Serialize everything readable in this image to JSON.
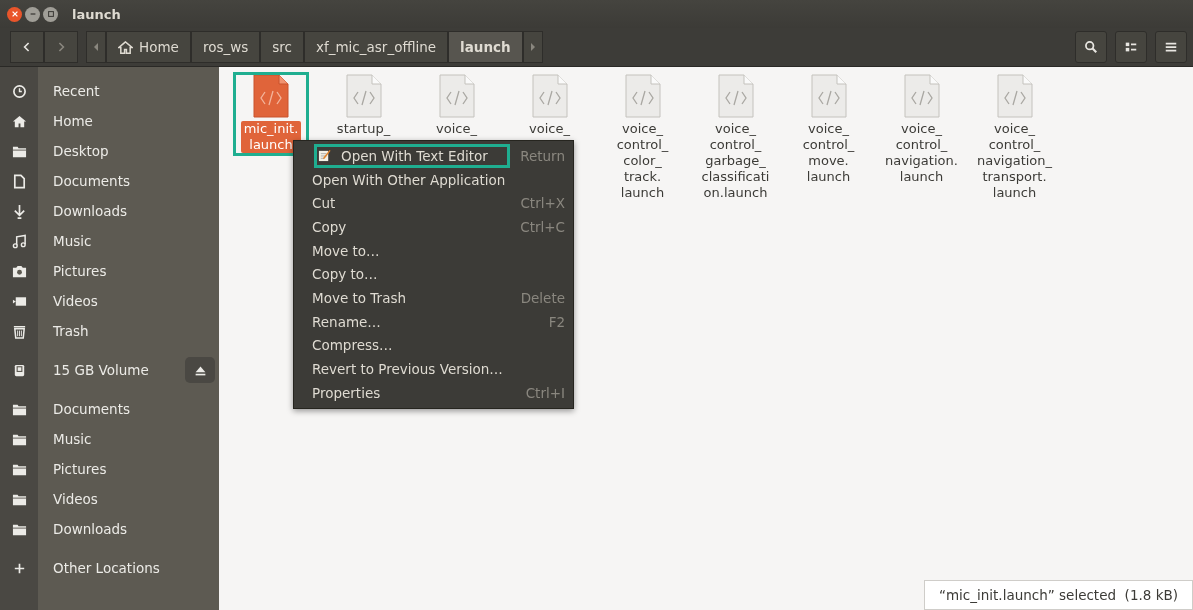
{
  "window": {
    "title": "launch"
  },
  "path_bar": [
    {
      "label": "Home",
      "selected": false
    },
    {
      "label": "ros_ws",
      "selected": false
    },
    {
      "label": "src",
      "selected": false
    },
    {
      "label": "xf_mic_asr_offline",
      "selected": false
    },
    {
      "label": "launch",
      "selected": true
    }
  ],
  "sidebar": {
    "items": [
      {
        "kind": "place",
        "label": "Recent"
      },
      {
        "kind": "place",
        "label": "Home"
      },
      {
        "kind": "place",
        "label": "Desktop"
      },
      {
        "kind": "place",
        "label": "Documents"
      },
      {
        "kind": "place",
        "label": "Downloads"
      },
      {
        "kind": "place",
        "label": "Music"
      },
      {
        "kind": "place",
        "label": "Pictures"
      },
      {
        "kind": "place",
        "label": "Videos"
      },
      {
        "kind": "place",
        "label": "Trash"
      },
      {
        "kind": "device",
        "label": "15 GB Volume"
      },
      {
        "kind": "bookmark",
        "label": "Documents"
      },
      {
        "kind": "bookmark",
        "label": "Music"
      },
      {
        "kind": "bookmark",
        "label": "Pictures"
      },
      {
        "kind": "bookmark",
        "label": "Videos"
      },
      {
        "kind": "bookmark",
        "label": "Downloads"
      },
      {
        "kind": "other",
        "label": "Other Locations"
      }
    ]
  },
  "files": [
    {
      "lines": [
        "mic_init.",
        "launch"
      ],
      "selected": true,
      "highlighted": true
    },
    {
      "lines": [
        "startup_"
      ],
      "selected": false,
      "highlighted": false
    },
    {
      "lines": [
        "voice_"
      ],
      "selected": false,
      "highlighted": false
    },
    {
      "lines": [
        "voice_"
      ],
      "selected": false,
      "highlighted": false
    },
    {
      "lines": [
        "voice_",
        "control_",
        "color_",
        "track.",
        "launch"
      ],
      "selected": false,
      "highlighted": false
    },
    {
      "lines": [
        "voice_",
        "control_",
        "garbage_",
        "classificati",
        "on.launch"
      ],
      "selected": false,
      "highlighted": false
    },
    {
      "lines": [
        "voice_",
        "control_",
        "move.",
        "launch"
      ],
      "selected": false,
      "highlighted": false
    },
    {
      "lines": [
        "voice_",
        "control_",
        "navigation.",
        "launch"
      ],
      "selected": false,
      "highlighted": false
    },
    {
      "lines": [
        "voice_",
        "control_",
        "navigation_",
        "transport.",
        "launch"
      ],
      "selected": false,
      "highlighted": false
    }
  ],
  "context_menu": [
    {
      "label": "Open With Text Editor",
      "shortcut": "Return",
      "highlighted": true
    },
    {
      "label": "Open With Other Application",
      "highlighted": false
    },
    {
      "label": "Cut",
      "shortcut": "Ctrl+X",
      "highlighted": false
    },
    {
      "label": "Copy",
      "shortcut": "Ctrl+C",
      "highlighted": false
    },
    {
      "label": "Move to…",
      "highlighted": false
    },
    {
      "label": "Copy to…",
      "highlighted": false
    },
    {
      "label": "Move to Trash",
      "shortcut": "Delete",
      "highlighted": false
    },
    {
      "label": "Rename…",
      "shortcut": "F2",
      "highlighted": false
    },
    {
      "label": "Compress…",
      "highlighted": false
    },
    {
      "label": "Revert to Previous Version…",
      "highlighted": false
    },
    {
      "label": "Properties",
      "shortcut": "Ctrl+I",
      "highlighted": false
    }
  ],
  "status_bar": {
    "text": "“mic_init.launch” selected  (1.8 kB)"
  }
}
